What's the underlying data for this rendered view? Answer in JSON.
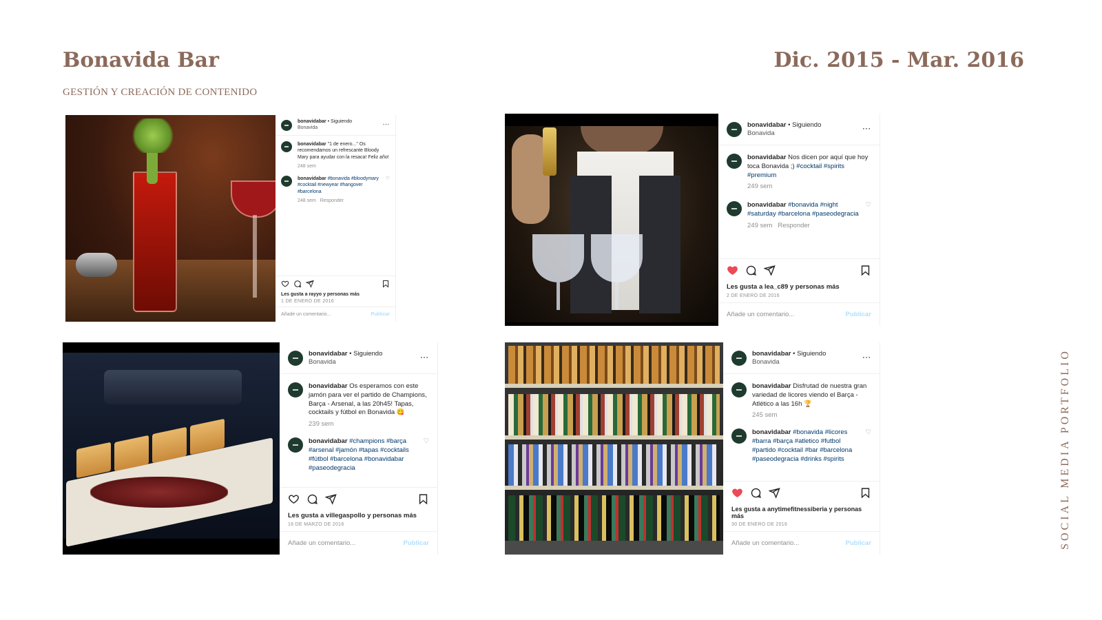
{
  "header": {
    "title": "Bonavida Bar",
    "dates": "Dic. 2015 - Mar. 2016",
    "subtitle": "GESTIÓN Y CREACIÓN DE CONTENIDO",
    "side_label": "SOCIAL MEDIA PORTFOLIO"
  },
  "colors": {
    "accent": "#8b6a5b",
    "hashtag": "#00376b",
    "like_red": "#ed4956",
    "publish": "#b2dffc"
  },
  "posts": [
    {
      "user": "bonavidabar",
      "following": "• Siguiendo",
      "location": "Bonavida",
      "caption_user": "bonavidabar",
      "caption": "\"1 de enero...\" Os recomendamos un refrescante Bloody Mary para ayudar con la resaca! Feliz año!",
      "caption_time": "248 sem",
      "tags_user": "bonavidabar",
      "tags": "#bonavida #bloodymary #cocktail #newyear #hangover #barcelona",
      "tags_time": "248 sem",
      "reply": "Responder",
      "likes": "Les gusta a rayyo y personas más",
      "date": "1 DE ENERO DE 2016",
      "add_comment": "Añade un comentario...",
      "publish": "Publicar",
      "liked": false
    },
    {
      "user": "bonavidabar",
      "following": "• Siguiendo",
      "location": "Bonavida",
      "caption_user": "bonavidabar",
      "caption": "Nos dicen por aquí que hoy toca Bonavida ;)",
      "caption_tags": "#cocktail #spirits #premium",
      "caption_time": "249 sem",
      "tags_user": "bonavidabar",
      "tags": "#bonavida #night #saturday #barcelona #paseodegracia",
      "tags_time": "249 sem",
      "reply": "Responder",
      "likes": "Les gusta a lea_c89 y personas más",
      "date": "2 DE ENERO DE 2016",
      "add_comment": "Añade un comentario...",
      "publish": "Publicar",
      "liked": true
    },
    {
      "user": "bonavidabar",
      "following": "• Siguiendo",
      "location": "Bonavida",
      "caption_user": "bonavidabar",
      "caption": "Os esperamos con este jamón para ver el partido de Champions, Barça - Arsenal, a las 20h45! Tapas, cocktails y fútbol en Bonavida 😋",
      "caption_time": "239 sem",
      "tags_user": "bonavidabar",
      "tags": "#champions #barça #arsenal #jamón #tapas #cocktails #fútbol #barcelona #bonavidabar #paseodegracia",
      "tags_time": "",
      "reply": "",
      "likes": "Les gusta a villegaspollo y personas más",
      "date": "16 DE MARZO DE 2016",
      "add_comment": "Añade un comentario...",
      "publish": "Publicar",
      "liked": false
    },
    {
      "user": "bonavidabar",
      "following": "• Siguiendo",
      "location": "Bonavida",
      "caption_user": "bonavidabar",
      "caption": "Disfrutad de nuestra gran variedad de licores viendo el Barça - Atlético a las 16h 🏆",
      "caption_time": "245 sem",
      "tags_user": "bonavidabar",
      "tags": "#bonavida #licores #barra #barça #atletico #futbol #partido #cocktail #bar #barcelona #paseodegracia #drinks #spirits",
      "tags_time": "",
      "reply": "",
      "likes": "Les gusta a anytimefitnessiberia y personas más",
      "date": "30 DE ENERO DE 2016",
      "add_comment": "Añade un comentario...",
      "publish": "Publicar",
      "liked": true
    }
  ]
}
